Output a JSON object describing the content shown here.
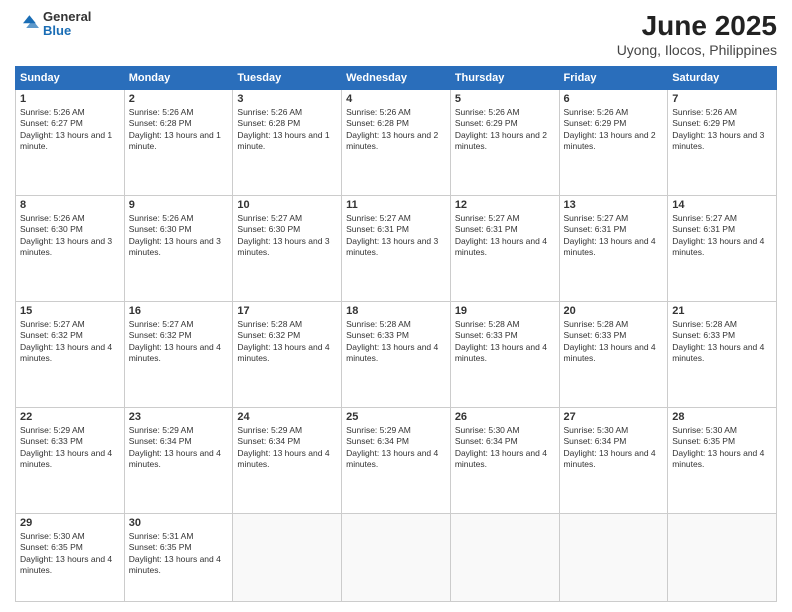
{
  "header": {
    "logo": {
      "general": "General",
      "blue": "Blue"
    },
    "title": "June 2025",
    "location": "Uyong, Ilocos, Philippines"
  },
  "days_of_week": [
    "Sunday",
    "Monday",
    "Tuesday",
    "Wednesday",
    "Thursday",
    "Friday",
    "Saturday"
  ],
  "weeks": [
    [
      {
        "day": "1",
        "sunrise": "5:26 AM",
        "sunset": "6:27 PM",
        "daylight": "13 hours and 1 minute."
      },
      {
        "day": "2",
        "sunrise": "5:26 AM",
        "sunset": "6:28 PM",
        "daylight": "13 hours and 1 minute."
      },
      {
        "day": "3",
        "sunrise": "5:26 AM",
        "sunset": "6:28 PM",
        "daylight": "13 hours and 1 minute."
      },
      {
        "day": "4",
        "sunrise": "5:26 AM",
        "sunset": "6:28 PM",
        "daylight": "13 hours and 2 minutes."
      },
      {
        "day": "5",
        "sunrise": "5:26 AM",
        "sunset": "6:29 PM",
        "daylight": "13 hours and 2 minutes."
      },
      {
        "day": "6",
        "sunrise": "5:26 AM",
        "sunset": "6:29 PM",
        "daylight": "13 hours and 2 minutes."
      },
      {
        "day": "7",
        "sunrise": "5:26 AM",
        "sunset": "6:29 PM",
        "daylight": "13 hours and 3 minutes."
      }
    ],
    [
      {
        "day": "8",
        "sunrise": "5:26 AM",
        "sunset": "6:30 PM",
        "daylight": "13 hours and 3 minutes."
      },
      {
        "day": "9",
        "sunrise": "5:26 AM",
        "sunset": "6:30 PM",
        "daylight": "13 hours and 3 minutes."
      },
      {
        "day": "10",
        "sunrise": "5:27 AM",
        "sunset": "6:30 PM",
        "daylight": "13 hours and 3 minutes."
      },
      {
        "day": "11",
        "sunrise": "5:27 AM",
        "sunset": "6:31 PM",
        "daylight": "13 hours and 3 minutes."
      },
      {
        "day": "12",
        "sunrise": "5:27 AM",
        "sunset": "6:31 PM",
        "daylight": "13 hours and 4 minutes."
      },
      {
        "day": "13",
        "sunrise": "5:27 AM",
        "sunset": "6:31 PM",
        "daylight": "13 hours and 4 minutes."
      },
      {
        "day": "14",
        "sunrise": "5:27 AM",
        "sunset": "6:31 PM",
        "daylight": "13 hours and 4 minutes."
      }
    ],
    [
      {
        "day": "15",
        "sunrise": "5:27 AM",
        "sunset": "6:32 PM",
        "daylight": "13 hours and 4 minutes."
      },
      {
        "day": "16",
        "sunrise": "5:27 AM",
        "sunset": "6:32 PM",
        "daylight": "13 hours and 4 minutes."
      },
      {
        "day": "17",
        "sunrise": "5:28 AM",
        "sunset": "6:32 PM",
        "daylight": "13 hours and 4 minutes."
      },
      {
        "day": "18",
        "sunrise": "5:28 AM",
        "sunset": "6:33 PM",
        "daylight": "13 hours and 4 minutes."
      },
      {
        "day": "19",
        "sunrise": "5:28 AM",
        "sunset": "6:33 PM",
        "daylight": "13 hours and 4 minutes."
      },
      {
        "day": "20",
        "sunrise": "5:28 AM",
        "sunset": "6:33 PM",
        "daylight": "13 hours and 4 minutes."
      },
      {
        "day": "21",
        "sunrise": "5:28 AM",
        "sunset": "6:33 PM",
        "daylight": "13 hours and 4 minutes."
      }
    ],
    [
      {
        "day": "22",
        "sunrise": "5:29 AM",
        "sunset": "6:33 PM",
        "daylight": "13 hours and 4 minutes."
      },
      {
        "day": "23",
        "sunrise": "5:29 AM",
        "sunset": "6:34 PM",
        "daylight": "13 hours and 4 minutes."
      },
      {
        "day": "24",
        "sunrise": "5:29 AM",
        "sunset": "6:34 PM",
        "daylight": "13 hours and 4 minutes."
      },
      {
        "day": "25",
        "sunrise": "5:29 AM",
        "sunset": "6:34 PM",
        "daylight": "13 hours and 4 minutes."
      },
      {
        "day": "26",
        "sunrise": "5:30 AM",
        "sunset": "6:34 PM",
        "daylight": "13 hours and 4 minutes."
      },
      {
        "day": "27",
        "sunrise": "5:30 AM",
        "sunset": "6:34 PM",
        "daylight": "13 hours and 4 minutes."
      },
      {
        "day": "28",
        "sunrise": "5:30 AM",
        "sunset": "6:35 PM",
        "daylight": "13 hours and 4 minutes."
      }
    ],
    [
      {
        "day": "29",
        "sunrise": "5:30 AM",
        "sunset": "6:35 PM",
        "daylight": "13 hours and 4 minutes."
      },
      {
        "day": "30",
        "sunrise": "5:31 AM",
        "sunset": "6:35 PM",
        "daylight": "13 hours and 4 minutes."
      },
      null,
      null,
      null,
      null,
      null
    ]
  ],
  "labels": {
    "sunrise": "Sunrise:",
    "sunset": "Sunset:",
    "daylight": "Daylight:"
  }
}
